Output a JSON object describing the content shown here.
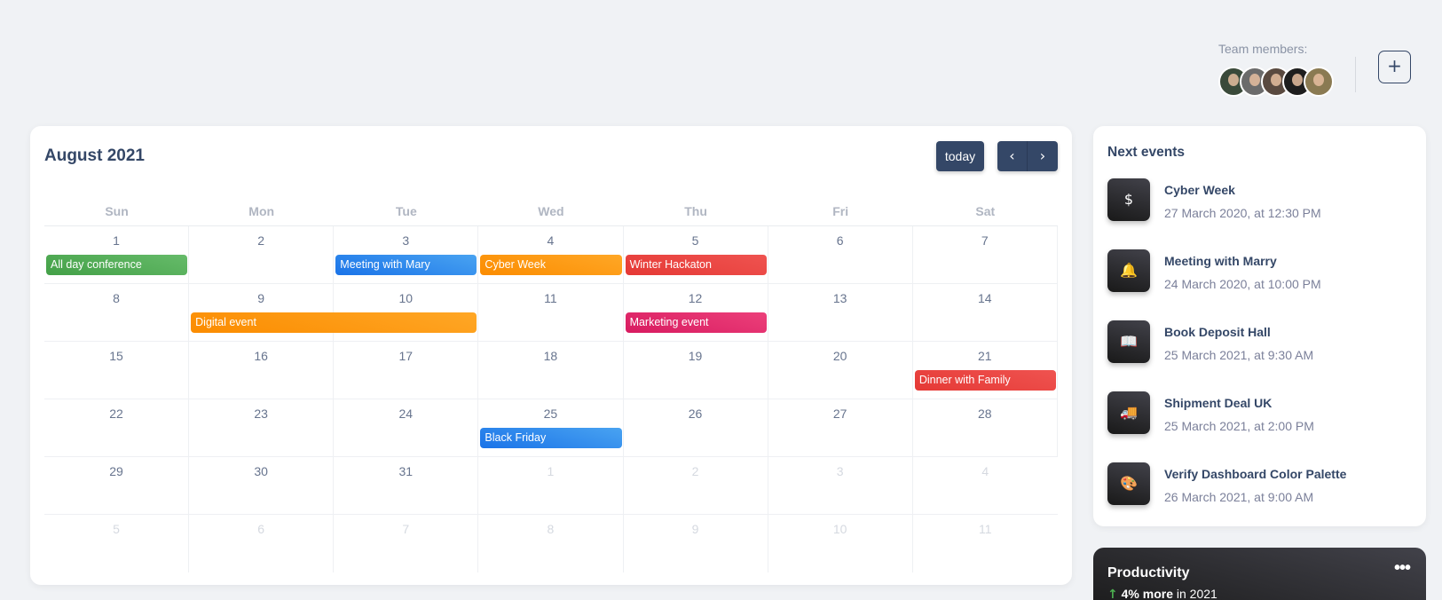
{
  "header": {
    "team_label": "Team members:",
    "avatars": [
      {
        "name": "avatar-1",
        "color": "#3a4a3a"
      },
      {
        "name": "avatar-2",
        "color": "#6b6b6b"
      },
      {
        "name": "avatar-3",
        "color": "#5a4a40"
      },
      {
        "name": "avatar-4",
        "color": "#1e1e1e"
      },
      {
        "name": "avatar-5",
        "color": "#8a7a52"
      }
    ],
    "add_label": "+"
  },
  "calendar": {
    "title": "August 2021",
    "today_label": "today",
    "prev_icon": "‹",
    "next_icon": "›",
    "weekdays": [
      "Sun",
      "Mon",
      "Tue",
      "Wed",
      "Thu",
      "Fri",
      "Sat"
    ],
    "weeks": [
      [
        {
          "d": "1"
        },
        {
          "d": "2"
        },
        {
          "d": "3"
        },
        {
          "d": "4"
        },
        {
          "d": "5"
        },
        {
          "d": "6"
        },
        {
          "d": "7"
        }
      ],
      [
        {
          "d": "8"
        },
        {
          "d": "9"
        },
        {
          "d": "10"
        },
        {
          "d": "11"
        },
        {
          "d": "12"
        },
        {
          "d": "13"
        },
        {
          "d": "14"
        }
      ],
      [
        {
          "d": "15"
        },
        {
          "d": "16"
        },
        {
          "d": "17"
        },
        {
          "d": "18"
        },
        {
          "d": "19"
        },
        {
          "d": "20"
        },
        {
          "d": "21"
        }
      ],
      [
        {
          "d": "22"
        },
        {
          "d": "23"
        },
        {
          "d": "24"
        },
        {
          "d": "25"
        },
        {
          "d": "26"
        },
        {
          "d": "27"
        },
        {
          "d": "28"
        }
      ],
      [
        {
          "d": "29"
        },
        {
          "d": "30"
        },
        {
          "d": "31"
        },
        {
          "d": "1",
          "other": true
        },
        {
          "d": "2",
          "other": true
        },
        {
          "d": "3",
          "other": true
        },
        {
          "d": "4",
          "other": true
        }
      ],
      [
        {
          "d": "5",
          "other": true
        },
        {
          "d": "6",
          "other": true
        },
        {
          "d": "7",
          "other": true
        },
        {
          "d": "8",
          "other": true
        },
        {
          "d": "9",
          "other": true
        },
        {
          "d": "10",
          "other": true
        },
        {
          "d": "11",
          "other": true
        }
      ]
    ],
    "events": [
      {
        "title": "All day conference",
        "week": 0,
        "start": 0,
        "span": 1,
        "color": "green"
      },
      {
        "title": "Meeting with Mary",
        "week": 0,
        "start": 2,
        "span": 1,
        "color": "blue"
      },
      {
        "title": "Cyber Week",
        "week": 0,
        "start": 3,
        "span": 1,
        "color": "orange"
      },
      {
        "title": "Winter Hackaton",
        "week": 0,
        "start": 4,
        "span": 1,
        "color": "red"
      },
      {
        "title": "Digital event",
        "week": 1,
        "start": 1,
        "span": 2,
        "color": "orange"
      },
      {
        "title": "Marketing event",
        "week": 1,
        "start": 4,
        "span": 1,
        "color": "pink"
      },
      {
        "title": "Dinner with Family",
        "week": 2,
        "start": 6,
        "span": 1,
        "color": "red"
      },
      {
        "title": "Black Friday",
        "week": 3,
        "start": 3,
        "span": 1,
        "color": "blue"
      }
    ]
  },
  "next_events": {
    "title": "Next events",
    "items": [
      {
        "icon": "dollar-icon",
        "glyph": "$",
        "name": "Cyber Week",
        "date": "27 March 2020, at 12:30 PM"
      },
      {
        "icon": "bell-icon",
        "glyph": "🔔",
        "name": "Meeting with Marry",
        "date": "24 March 2020, at 10:00 PM"
      },
      {
        "icon": "book-icon",
        "glyph": "📖",
        "name": "Book Deposit Hall",
        "date": "25 March 2021, at 9:30 AM"
      },
      {
        "icon": "truck-icon",
        "glyph": "🚚",
        "name": "Shipment Deal UK",
        "date": "25 March 2021, at 2:00 PM"
      },
      {
        "icon": "palette-icon",
        "glyph": "🎨",
        "name": "Verify Dashboard Color Palette",
        "date": "26 March 2021, at 9:00 AM"
      }
    ]
  },
  "productivity": {
    "title": "Productivity",
    "more_icon": "•••",
    "arrow_icon": "↑",
    "highlight": "4% more",
    "suffix": " in 2021"
  }
}
